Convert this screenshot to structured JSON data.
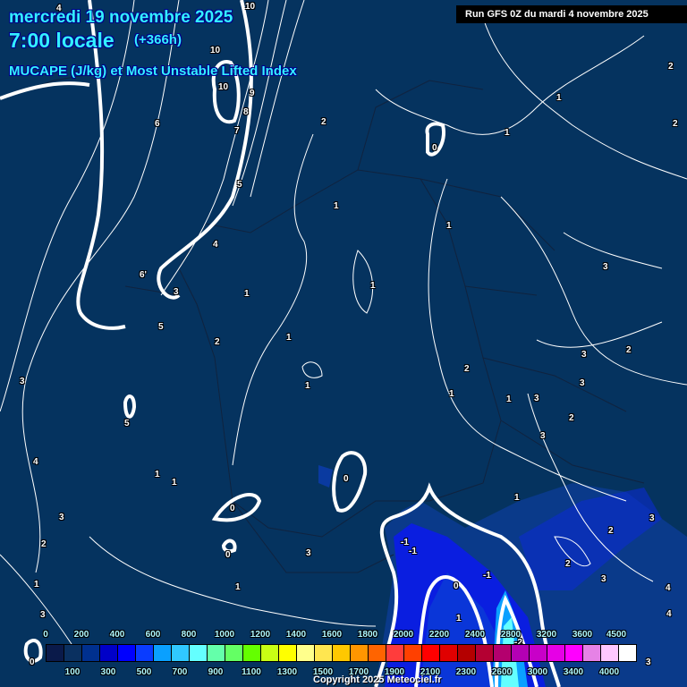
{
  "header": {
    "date": "mercredi 19 novembre 2025",
    "hour": "7:00 locale",
    "lead": "(+366h)",
    "parameter": "MUCAPE (J/kg) et Most Unstable Lifted Index",
    "run": "Run GFS 0Z du mardi 4 novembre 2025"
  },
  "contour_labels": [
    "4",
    "10",
    "10",
    "10",
    "9",
    "8",
    "7",
    "6",
    "5",
    "4",
    "6'",
    "3",
    "5",
    "2",
    "3",
    "5",
    "4",
    "1",
    "1",
    "0",
    "0",
    "3",
    "2",
    "3",
    "1",
    "1",
    "3",
    "0",
    "2",
    "0",
    "1",
    "1",
    "1",
    "1",
    "1",
    "1",
    "2",
    "1",
    "1",
    "3",
    "2",
    "3",
    "3",
    "3",
    "2",
    "3",
    "2",
    "2",
    "1",
    "1",
    "0",
    "1",
    "2",
    "3",
    "2",
    "3",
    "4",
    "4",
    "-1",
    "-1",
    "-1",
    "0",
    "1",
    "3",
    "-2"
  ],
  "colorbar": {
    "colors": [
      "#0a1a4a",
      "#0a3060",
      "#00308f",
      "#0000c8",
      "#0000ff",
      "#0a3cff",
      "#0aa0ff",
      "#30c8ff",
      "#64ffff",
      "#64ffaa",
      "#64ff64",
      "#64ff00",
      "#c8ff14",
      "#ffff00",
      "#ffff8c",
      "#ffe650",
      "#ffc800",
      "#ff9600",
      "#ff6400",
      "#ff3c3c",
      "#ff4000",
      "#ff0000",
      "#e00000",
      "#b40000",
      "#b40032",
      "#b4006e",
      "#b400b4",
      "#c800c8",
      "#e600e6",
      "#ff00ff",
      "#e682e6",
      "#ffc8ff",
      "#ffffff"
    ],
    "top_labels": [
      "0",
      "200",
      "400",
      "600",
      "800",
      "1000",
      "1200",
      "1400",
      "1600",
      "1800",
      "2000",
      "2200",
      "2400",
      "2800",
      "3200",
      "3600",
      "4500"
    ],
    "bottom_labels": [
      "100",
      "300",
      "500",
      "700",
      "900",
      "1100",
      "1300",
      "1500",
      "1700",
      "1900",
      "2100",
      "2300",
      "2600",
      "3000",
      "3400",
      "4000"
    ]
  },
  "copyright": "Copyright 2025 Meteociel.fr"
}
